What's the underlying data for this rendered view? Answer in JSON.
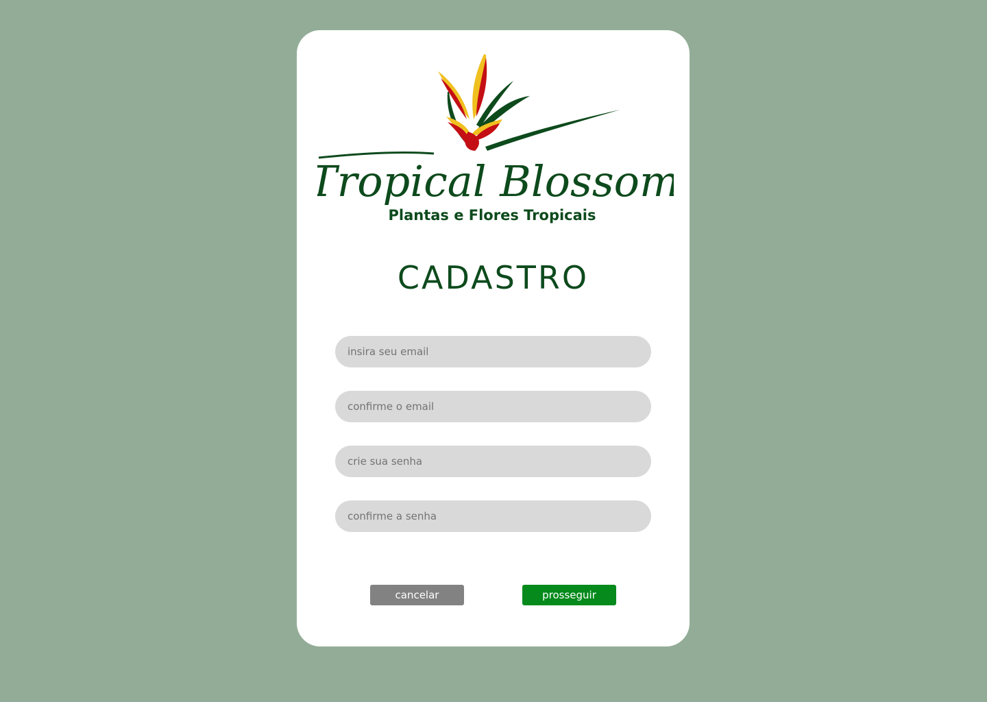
{
  "logo": {
    "brand": "Tropical Blossom",
    "tagline": "Plantas e Flores Tropicais"
  },
  "form": {
    "title": "CADASTRO",
    "email_placeholder": "insira seu email",
    "confirm_email_placeholder": "confirme o email",
    "password_placeholder": "crie sua senha",
    "confirm_password_placeholder": "confirme a senha"
  },
  "actions": {
    "cancel_label": "cancelar",
    "proceed_label": "prosseguir"
  },
  "colors": {
    "background": "#93ac97",
    "brand_green": "#0d4a1c",
    "flower_red": "#c40f14",
    "flower_yellow": "#f0c020",
    "field_gray": "#d9d9d9",
    "cancel_gray": "#828282",
    "proceed_green": "#058a1b"
  }
}
